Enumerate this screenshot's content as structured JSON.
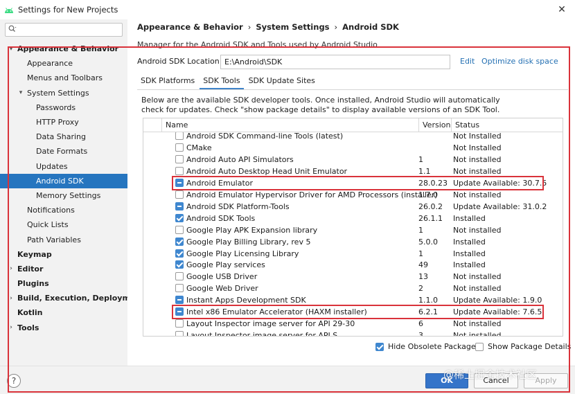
{
  "window": {
    "title": "Settings for New Projects",
    "close_icon": "close-icon",
    "logo_icon": "android-studio-logo-icon"
  },
  "colors": {
    "selected": "#2675bf",
    "link": "#2470b3",
    "checkbox": "#3f87cf",
    "highlight": "#d9323a",
    "primary_button": "#3574c9"
  },
  "sidebar": {
    "search": {
      "value": "",
      "placeholder": ""
    },
    "items": [
      {
        "label": "Appearance & Behavior",
        "arrow": "▾",
        "bold": true,
        "indent": 0,
        "selected": false
      },
      {
        "label": "Appearance",
        "arrow": "",
        "bold": false,
        "indent": 1,
        "selected": false
      },
      {
        "label": "Menus and Toolbars",
        "arrow": "",
        "bold": false,
        "indent": 1,
        "selected": false
      },
      {
        "label": "System Settings",
        "arrow": "▾",
        "bold": false,
        "indent": 1,
        "selected": false
      },
      {
        "label": "Passwords",
        "arrow": "",
        "bold": false,
        "indent": 2,
        "selected": false
      },
      {
        "label": "HTTP Proxy",
        "arrow": "",
        "bold": false,
        "indent": 2,
        "selected": false
      },
      {
        "label": "Data Sharing",
        "arrow": "",
        "bold": false,
        "indent": 2,
        "selected": false
      },
      {
        "label": "Date Formats",
        "arrow": "",
        "bold": false,
        "indent": 2,
        "selected": false
      },
      {
        "label": "Updates",
        "arrow": "",
        "bold": false,
        "indent": 2,
        "selected": false
      },
      {
        "label": "Android SDK",
        "arrow": "",
        "bold": false,
        "indent": 2,
        "selected": true
      },
      {
        "label": "Memory Settings",
        "arrow": "",
        "bold": false,
        "indent": 2,
        "selected": false
      },
      {
        "label": "Notifications",
        "arrow": "",
        "bold": false,
        "indent": 1,
        "selected": false
      },
      {
        "label": "Quick Lists",
        "arrow": "",
        "bold": false,
        "indent": 1,
        "selected": false
      },
      {
        "label": "Path Variables",
        "arrow": "",
        "bold": false,
        "indent": 1,
        "selected": false
      },
      {
        "label": "Keymap",
        "arrow": "",
        "bold": true,
        "indent": 0,
        "selected": false
      },
      {
        "label": "Editor",
        "arrow": "›",
        "bold": true,
        "indent": 0,
        "selected": false
      },
      {
        "label": "Plugins",
        "arrow": "",
        "bold": true,
        "indent": 0,
        "selected": false
      },
      {
        "label": "Build, Execution, Deployment",
        "arrow": "›",
        "bold": true,
        "indent": 0,
        "selected": false
      },
      {
        "label": "Kotlin",
        "arrow": "",
        "bold": true,
        "indent": 0,
        "selected": false
      },
      {
        "label": "Tools",
        "arrow": "›",
        "bold": true,
        "indent": 0,
        "selected": false
      }
    ]
  },
  "breadcrumb": [
    "Appearance & Behavior",
    "System Settings",
    "Android SDK"
  ],
  "breadcrumb_sep": "›",
  "description": "Manager for the Android SDK and Tools used by Android Studio",
  "location": {
    "label": "Android SDK Location:",
    "value": "E:\\Android\\SDK",
    "edit": "Edit",
    "optimize": "Optimize disk space"
  },
  "tabs": [
    {
      "label": "SDK Platforms",
      "active": false
    },
    {
      "label": "SDK Tools",
      "active": true
    },
    {
      "label": "SDK Update Sites",
      "active": false
    }
  ],
  "note": "Below are the available SDK developer tools. Once installed, Android Studio will automatically check for updates. Check \"show package details\" to display available versions of an SDK Tool.",
  "table": {
    "columns": [
      "Name",
      "Version",
      "Status"
    ],
    "rows": [
      {
        "name": "Android SDK Command-line Tools (latest)",
        "version": "",
        "status": "Not Installed",
        "state": "unchecked"
      },
      {
        "name": "CMake",
        "version": "",
        "status": "Not Installed",
        "state": "unchecked"
      },
      {
        "name": "Android Auto API Simulators",
        "version": "1",
        "status": "Not installed",
        "state": "unchecked"
      },
      {
        "name": "Android Auto Desktop Head Unit Emulator",
        "version": "1.1",
        "status": "Not installed",
        "state": "unchecked"
      },
      {
        "name": "Android Emulator",
        "version": "28.0.23",
        "status": "Update Available: 30.7.5",
        "state": "partial",
        "highlight": true
      },
      {
        "name": "Android Emulator Hypervisor Driver for AMD Processors (installer)",
        "version": "1.7.0",
        "status": "Not installed",
        "state": "unchecked"
      },
      {
        "name": "Android SDK Platform-Tools",
        "version": "26.0.2",
        "status": "Update Available: 31.0.2",
        "state": "partial"
      },
      {
        "name": "Android SDK Tools",
        "version": "26.1.1",
        "status": "Installed",
        "state": "checked"
      },
      {
        "name": "Google Play APK Expansion library",
        "version": "1",
        "status": "Not installed",
        "state": "unchecked"
      },
      {
        "name": "Google Play Billing Library, rev 5",
        "version": "5.0.0",
        "status": "Installed",
        "state": "checked"
      },
      {
        "name": "Google Play Licensing Library",
        "version": "1",
        "status": "Installed",
        "state": "checked"
      },
      {
        "name": "Google Play services",
        "version": "49",
        "status": "Installed",
        "state": "checked"
      },
      {
        "name": "Google USB Driver",
        "version": "13",
        "status": "Not installed",
        "state": "unchecked"
      },
      {
        "name": "Google Web Driver",
        "version": "2",
        "status": "Not installed",
        "state": "unchecked"
      },
      {
        "name": "Instant Apps Development SDK",
        "version": "1.1.0",
        "status": "Update Available: 1.9.0",
        "state": "partial"
      },
      {
        "name": "Intel x86 Emulator Accelerator (HAXM installer)",
        "version": "6.2.1",
        "status": "Update Available: 7.6.5",
        "state": "partial",
        "highlight": true
      },
      {
        "name": "Layout Inspector image server for API 29-30",
        "version": "6",
        "status": "Not installed",
        "state": "unchecked"
      },
      {
        "name": "Layout Inspector image server for API S",
        "version": "3",
        "status": "Not installed",
        "state": "unchecked"
      }
    ]
  },
  "options": {
    "hide_obsolete": {
      "label": "Hide Obsolete Packages",
      "checked": true
    },
    "show_details": {
      "label": "Show Package Details",
      "checked": false
    }
  },
  "buttons": {
    "help": "?",
    "ok": "OK",
    "cancel": "Cancel",
    "apply": "Apply"
  },
  "watermark": "@稀土掘金技术社区"
}
